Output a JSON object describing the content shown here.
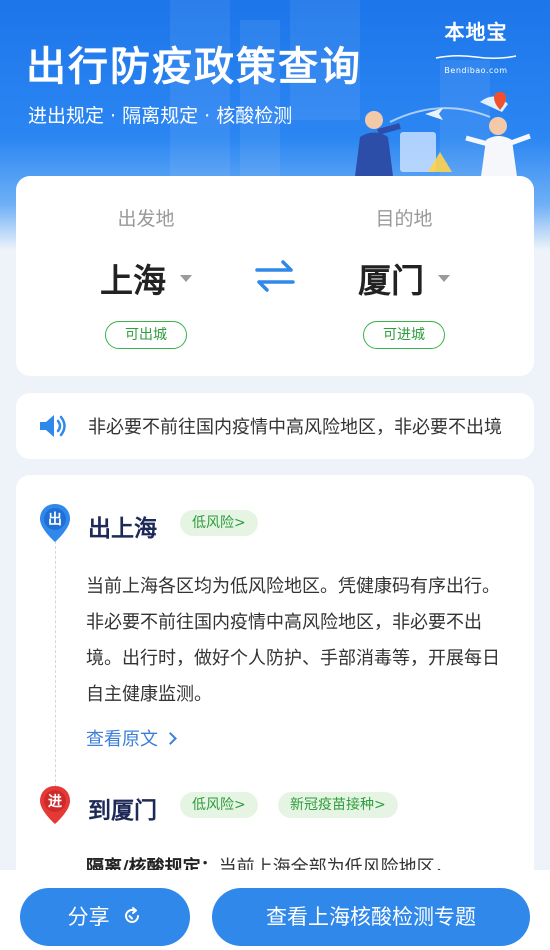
{
  "hero": {
    "title": "出行防疫政策查询",
    "subtitle": "进出规定 · 隔离规定 · 核酸检测",
    "brand": "本地宝",
    "brand_sub": "Bendibao.com"
  },
  "route": {
    "from_label": "出发地",
    "from_city": "上海",
    "from_status": "可出城",
    "to_label": "目的地",
    "to_city": "厦门",
    "to_status": "可进城"
  },
  "notice": {
    "text": "非必要不前往国内疫情中高风险地区，非必要不出境"
  },
  "detail": {
    "out_badge": "出",
    "out_title": "出上海",
    "out_risk": "低风险>",
    "out_body": "当前上海各区均为低风险地区。凭健康码有序出行。非必要不前往国内疫情中高风险地区，非必要不出境。出行时，做好个人防护、手部消毒等，开展每日自主健康监测。",
    "view_original": "查看原文",
    "in_badge": "进",
    "in_title": "到厦门",
    "in_risk": "低风险>",
    "in_vaccine": "新冠疫苗接种>",
    "rule_label": "隔离/核酸规定：",
    "rule_text": "当前上海全部为低风险地区，"
  },
  "actions": {
    "share": "分享",
    "topic": "查看上海核酸检测专题"
  },
  "colors": {
    "primary": "#2f88ea",
    "green": "#37b34a",
    "dark_title": "#1d2a57",
    "out_pin": "#2f88ea",
    "in_pin": "#e53935"
  }
}
